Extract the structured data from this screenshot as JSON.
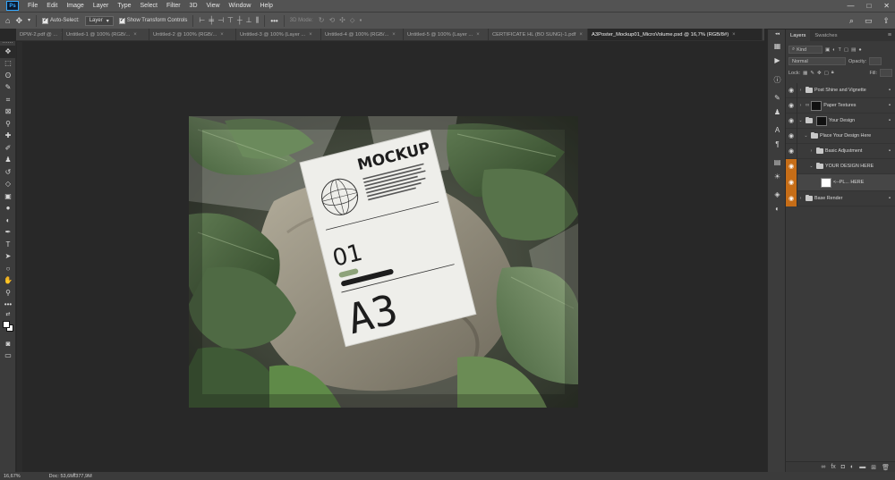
{
  "app": {
    "logo": "Ps"
  },
  "menu": [
    "File",
    "Edit",
    "Image",
    "Layer",
    "Type",
    "Select",
    "Filter",
    "3D",
    "View",
    "Window",
    "Help"
  ],
  "window_controls": {
    "minimize": "—",
    "maximize": "□",
    "close": "✕"
  },
  "options": {
    "auto_select_label": "Auto-Select:",
    "auto_select_value": "Layer",
    "show_transform_label": "Show Transform Controls",
    "more_label": "•••",
    "mode_3d_label": "3D Mode:"
  },
  "tabs": [
    {
      "label": "DPW-2.pdf @ ...",
      "close": "×"
    },
    {
      "label": "Untitled-1 @ 100% (RGB/...",
      "close": "×"
    },
    {
      "label": "Untitled-2 @ 100% (RGB/...",
      "close": "×"
    },
    {
      "label": "Untitled-3 @ 100% (Layer ...",
      "close": "×"
    },
    {
      "label": "Untitled-4 @ 100% (RGB/...",
      "close": "×"
    },
    {
      "label": "Untitled-5 @ 100% (Layer ...",
      "close": "×"
    },
    {
      "label": "CERTIFICATE HL (BO SUNG)-1.pdf",
      "close": "×"
    },
    {
      "label": "A3Poster_Mockup01_MicroVolume.psd @ 16,7% (RGB/8#)",
      "close": "×"
    }
  ],
  "layers_panel": {
    "tab_layers": "Layers",
    "tab_swatches": "Swatches",
    "filter_kind": "Kind",
    "blend_mode": "Normal",
    "opacity_label": "Opacity:",
    "lock_label": "Lock:",
    "fill_label": "Fill:",
    "layers": [
      {
        "name": "Post Shine and Vignette"
      },
      {
        "name": "Paper Textures"
      },
      {
        "name": "Your Design"
      },
      {
        "name": "Place Your Design Here"
      },
      {
        "name": "Basic Adjustment"
      },
      {
        "name": "YOUR DESIGN HERE"
      },
      {
        "name": "<--PL... HERE"
      },
      {
        "name": "Base Render"
      }
    ]
  },
  "mockup": {
    "heading": "MOCKUP",
    "number": "01",
    "size": "A3"
  },
  "status": {
    "zoom": "16,67%",
    "doc_label": "Doc: 53,6M/377,9M"
  },
  "colors": {
    "accent": "#31a8ff",
    "eye_highlight": "#c66d17",
    "foreground": "#ffffff",
    "background": "#ffffff"
  }
}
